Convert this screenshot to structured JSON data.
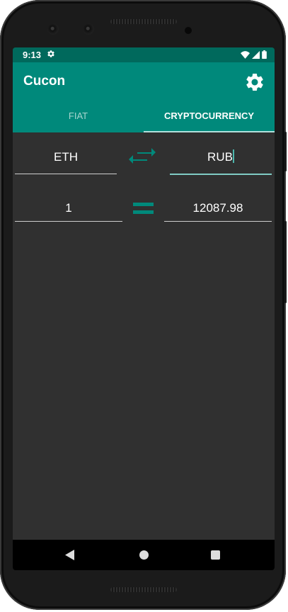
{
  "status_bar": {
    "time": "9:13"
  },
  "app_bar": {
    "title": "Cucon"
  },
  "tabs": [
    {
      "label": "FIAT",
      "selected": false
    },
    {
      "label": "CRYPTOCURRENCY",
      "selected": true
    }
  ],
  "converter": {
    "from_currency": "ETH",
    "to_currency": "RUB",
    "amount": "1",
    "result": "12087.98"
  },
  "colors": {
    "primary": "#00897b",
    "primary_dark": "#00695c",
    "accent": "#80cbc4",
    "background": "#303030"
  }
}
